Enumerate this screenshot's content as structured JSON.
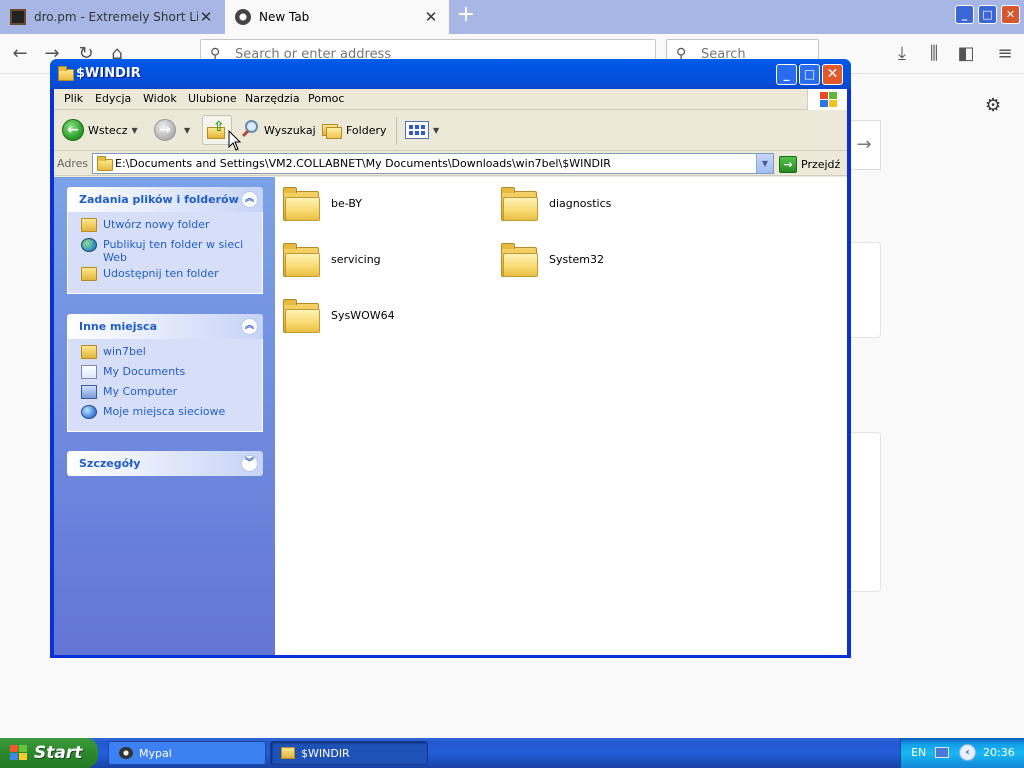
{
  "browser": {
    "tabs": [
      {
        "title": "dro.pm - Extremely Short Links",
        "active": false
      },
      {
        "title": "New Tab",
        "active": true
      }
    ],
    "new_tab_symbol": "+",
    "close_symbol": "✕",
    "url_placeholder": "Search or enter address",
    "search_placeholder": "Search",
    "window_controls": {
      "minimize": "_",
      "maximize": "□",
      "close": "✕"
    }
  },
  "explorer": {
    "title": "$WINDIR",
    "menu": [
      "Plik",
      "Edycja",
      "Widok",
      "Ulubione",
      "Narzędzia",
      "Pomoc"
    ],
    "toolbar": {
      "back_label": "Wstecz",
      "search_label": "Wyszukaj",
      "folders_label": "Foldery"
    },
    "address": {
      "label": "Adres",
      "path": "E:\\Documents and Settings\\VM2.COLLABNET\\My Documents\\Downloads\\win7bel\\$WINDIR",
      "go_label": "Przejdź"
    },
    "tasks": {
      "file_tasks_title": "Zadania plików i folderów",
      "file_tasks": [
        {
          "label": "Utwórz nowy folder",
          "icon": "new-folder-icon"
        },
        {
          "label": "Publikuj ten folder w sieci Web",
          "icon": "publish-web-icon"
        },
        {
          "label": "Udostępnij ten folder",
          "icon": "share-folder-icon"
        }
      ],
      "other_places_title": "Inne miejsca",
      "other_places": [
        {
          "label": "win7bel",
          "icon": "folder-icon"
        },
        {
          "label": "My Documents",
          "icon": "my-documents-icon"
        },
        {
          "label": "My Computer",
          "icon": "my-computer-icon"
        },
        {
          "label": "Moje miejsca sieciowe",
          "icon": "network-places-icon"
        }
      ],
      "details_title": "Szczegóły"
    },
    "folders": [
      "be-BY",
      "diagnostics",
      "servicing",
      "System32",
      "SysWOW64"
    ]
  },
  "taskbar": {
    "start_label": "Start",
    "buttons": [
      {
        "label": "Mypal",
        "active": false
      },
      {
        "label": "$WINDIR",
        "active": true
      }
    ],
    "tray": {
      "language": "EN",
      "clock": "20:36"
    }
  },
  "colors": {
    "xp_title_blue": "#0054e3",
    "taskbar_blue": "#245ed8",
    "start_green": "#2f8c2f",
    "task_link_blue": "#215dc6",
    "browser_tabbar": "#a8b6e6"
  }
}
